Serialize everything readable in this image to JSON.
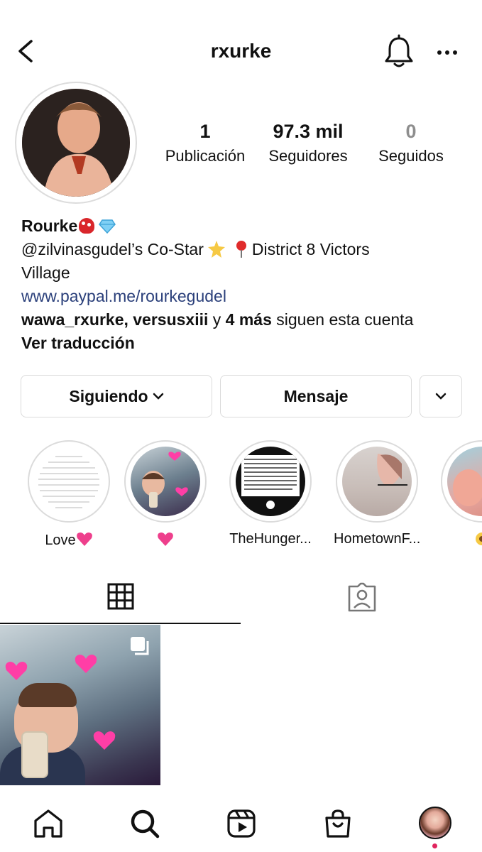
{
  "header": {
    "username": "rxurke"
  },
  "stats": {
    "posts": {
      "value": "1",
      "label": "Publicación"
    },
    "followers": {
      "value": "97.3 mil",
      "label": "Seguidores"
    },
    "following": {
      "value": "0",
      "label": "Seguidos"
    }
  },
  "bio": {
    "name": "Rourke",
    "line1_a": "@zilvinasgudel’s Co-Star",
    "line1_b": "District 8 Victors",
    "line2": "Village",
    "link": "www.paypal.me/rourkegudel",
    "followed_by_users": "wawa_rxurke, versusxiii",
    "followed_by_mid": " y ",
    "followed_by_more": "4 más",
    "followed_by_tail": " siguen esta cuenta",
    "translate": "Ver traducción"
  },
  "buttons": {
    "following": "Siguiendo",
    "message": "Mensaje"
  },
  "highlights": [
    {
      "label": "Love"
    },
    {
      "label": ""
    },
    {
      "label": "TheHunger..."
    },
    {
      "label": "HometownF..."
    },
    {
      "label": ""
    }
  ],
  "colors": {
    "link": "#2a3f7a",
    "notification_dot": "#e0245e",
    "border": "#dbdbdb"
  }
}
